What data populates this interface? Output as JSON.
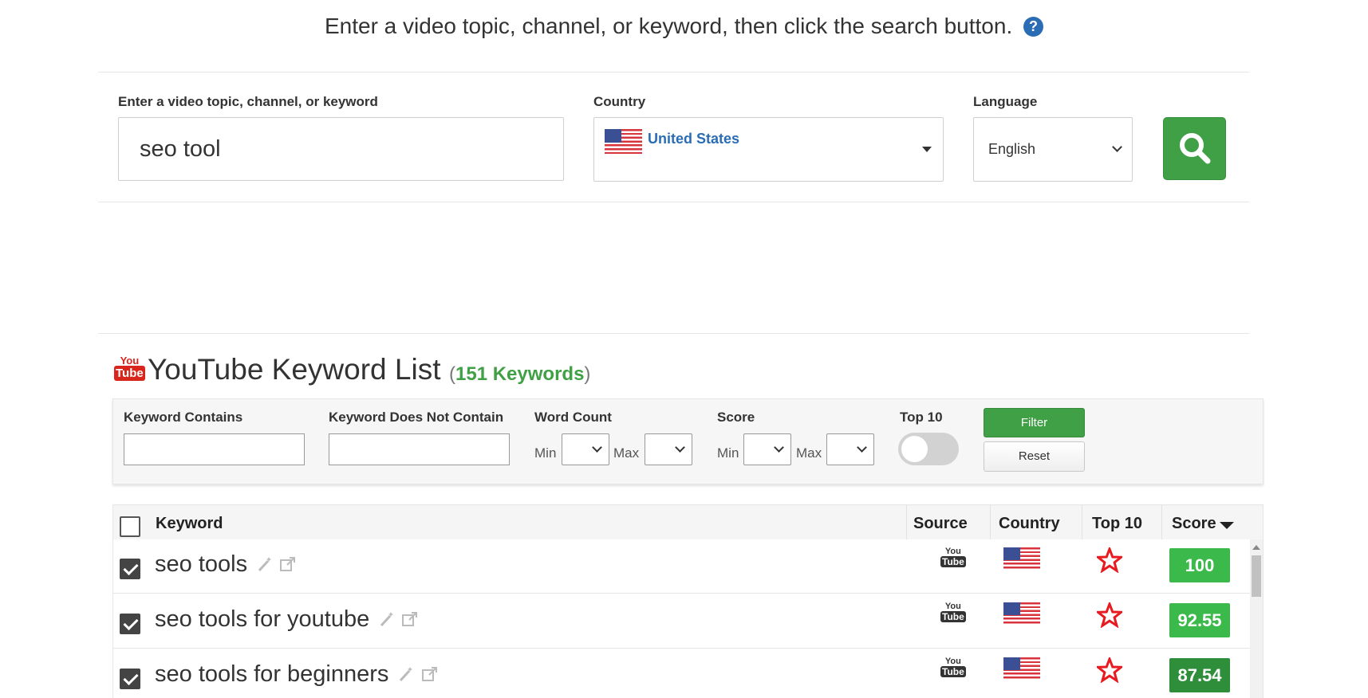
{
  "instruction": {
    "text": "Enter a video topic, channel, or keyword, then click the search button.",
    "help_icon": "?"
  },
  "search": {
    "topic_label": "Enter a video topic, channel, or keyword",
    "topic_value": "seo tool",
    "country_label": "Country",
    "country_value": "United States",
    "language_label": "Language",
    "language_value": "English",
    "button_icon": "search-icon"
  },
  "keyword_list": {
    "logo": {
      "you": "You",
      "tube": "Tube"
    },
    "title": "YouTube Keyword List",
    "count_open": "(",
    "count": "151 Keywords",
    "count_close": ")"
  },
  "filters": {
    "contains_label": "Keyword Contains",
    "not_contains_label": "Keyword Does Not Contain",
    "word_count_label": "Word Count",
    "score_label": "Score",
    "top10_label": "Top 10",
    "min_label": "Min",
    "max_label": "Max",
    "filter_button": "Filter",
    "reset_button": "Reset",
    "top10_enabled": false
  },
  "table": {
    "headers": {
      "keyword": "Keyword",
      "source": "Source",
      "country": "Country",
      "top10": "Top 10",
      "score": "Score"
    },
    "rows": [
      {
        "keyword": "seo tools",
        "source": "YouTube",
        "country": "United States",
        "top10": true,
        "score": "100",
        "score_color": "#3bb94a"
      },
      {
        "keyword": "seo tools for youtube",
        "source": "YouTube",
        "country": "United States",
        "top10": true,
        "score": "92.55",
        "score_color": "#3bb94a"
      },
      {
        "keyword": "seo tools for beginners",
        "source": "YouTube",
        "country": "United States",
        "top10": true,
        "score": "87.54",
        "score_color": "#2f8e3a"
      }
    ]
  },
  "colors": {
    "accent_green": "#40a045",
    "link_blue": "#2a6db5",
    "youtube_red": "#d9261c",
    "star_red": "#e8191f"
  }
}
